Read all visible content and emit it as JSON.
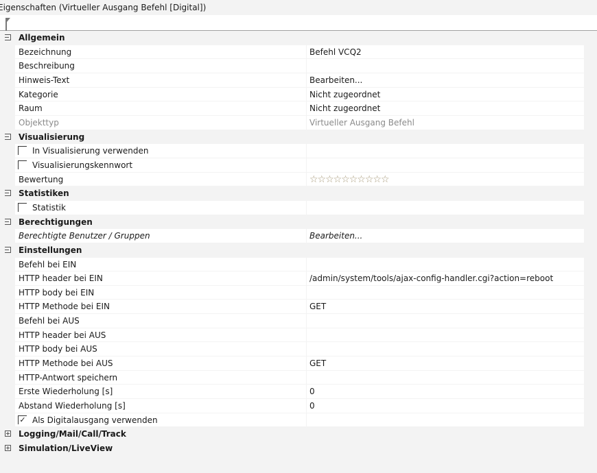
{
  "window": {
    "title": "Eigenschaften (Virtueller Ausgang Befehl [Digital])"
  },
  "rating": {
    "value": 0,
    "max": 10,
    "stars": "☆☆☆☆☆☆☆☆☆☆"
  },
  "categories": [
    {
      "name": "Allgemein",
      "expanded": true,
      "items": [
        {
          "label": "Bezeichnung",
          "value": "Befehl VCQ2"
        },
        {
          "label": "Beschreibung",
          "value": ""
        },
        {
          "label": "Hinweis-Text",
          "value": "Bearbeiten..."
        },
        {
          "label": "Kategorie",
          "value": "Nicht zugeordnet"
        },
        {
          "label": "Raum",
          "value": "Nicht zugeordnet"
        },
        {
          "label": "Objekttyp",
          "value": "Virtueller Ausgang Befehl",
          "disabled": true
        }
      ]
    },
    {
      "name": "Visualisierung",
      "expanded": true,
      "items": [
        {
          "label": "In Visualisierung verwenden",
          "checkbox": true,
          "checked": false,
          "value": ""
        },
        {
          "label": "Visualisierungskennwort",
          "checkbox": true,
          "checked": false,
          "value": ""
        },
        {
          "label": "Bewertung",
          "rating": true,
          "value": ""
        }
      ]
    },
    {
      "name": "Statistiken",
      "expanded": true,
      "items": [
        {
          "label": "Statistik",
          "checkbox": true,
          "checked": false,
          "value": ""
        }
      ]
    },
    {
      "name": "Berechtigungen",
      "expanded": true,
      "items": [
        {
          "label": "Berechtigte Benutzer / Gruppen",
          "value": "Bearbeiten...",
          "italic": true
        }
      ]
    },
    {
      "name": "Einstellungen",
      "expanded": true,
      "items": [
        {
          "label": "Befehl bei EIN",
          "value": ""
        },
        {
          "label": "HTTP header bei EIN",
          "value": "/admin/system/tools/ajax-config-handler.cgi?action=reboot"
        },
        {
          "label": "HTTP body bei EIN",
          "value": ""
        },
        {
          "label": "HTTP Methode bei EIN",
          "value": "GET"
        },
        {
          "label": "Befehl bei AUS",
          "value": ""
        },
        {
          "label": "HTTP header bei AUS",
          "value": ""
        },
        {
          "label": "HTTP body bei AUS",
          "value": ""
        },
        {
          "label": "HTTP Methode bei AUS",
          "value": "GET"
        },
        {
          "label": "HTTP-Antwort speichern",
          "value": ""
        },
        {
          "label": "Erste Wiederholung [s]",
          "value": "0"
        },
        {
          "label": "Abstand Wiederholung [s]",
          "value": "0"
        },
        {
          "label": "Als Digitalausgang verwenden",
          "checkbox": true,
          "checked": true,
          "value": ""
        }
      ]
    },
    {
      "name": "Logging/Mail/Call/Track",
      "expanded": false,
      "items": []
    },
    {
      "name": "Simulation/LiveView",
      "expanded": false,
      "items": []
    }
  ]
}
